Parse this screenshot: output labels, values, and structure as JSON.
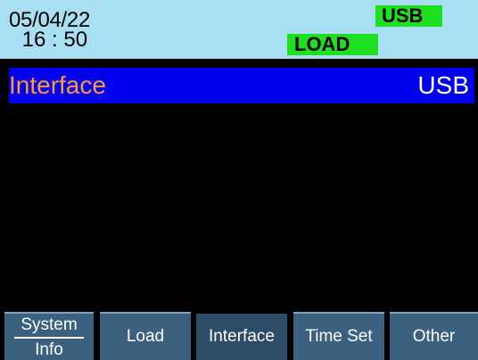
{
  "status": {
    "date": "05/04/22",
    "time": " 16 : 50",
    "badge_top": "USB",
    "badge_bottom": "LOAD"
  },
  "main": {
    "selected_label": "Interface",
    "selected_value": "USB"
  },
  "softkeys": {
    "system_line1": "System",
    "system_line2": "Info",
    "load": "Load",
    "interface": "Interface",
    "time_set": "Time Set",
    "other": "Other"
  },
  "colors": {
    "status_bar_bg": "#a9dff3",
    "badge_bg": "#1ee01e",
    "selection_bg": "#0000ee",
    "label_color": "#ff9a33",
    "softkey_bg": "#3b6080"
  }
}
